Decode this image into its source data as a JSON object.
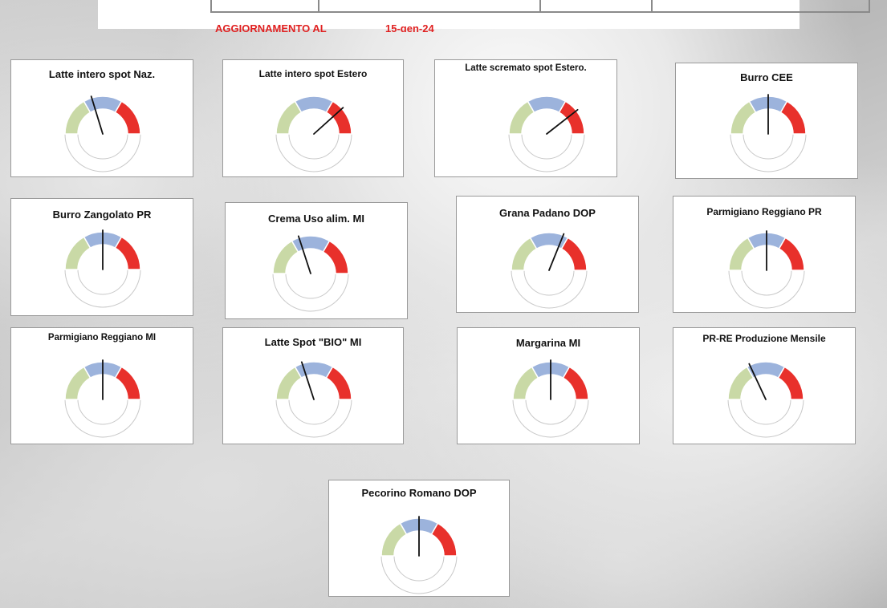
{
  "header": {
    "update_label": "AGGIORNAMENTO AL",
    "update_date": "15-gen-24"
  },
  "colors": {
    "low": "#c9d9a6",
    "mid": "#9cb3dc",
    "high": "#e8302b",
    "needle": "#111111",
    "update_text": "#e02020"
  },
  "gauges": [
    {
      "title": "Latte intero spot Naz.",
      "needle_angle_deg": -17
    },
    {
      "title": "Latte intero spot Estero",
      "needle_angle_deg": 48
    },
    {
      "title": "Latte scremato spot Estero.",
      "needle_angle_deg": 52
    },
    {
      "title": "Burro CEE",
      "needle_angle_deg": 0
    },
    {
      "title": "Burro Zangolato PR",
      "needle_angle_deg": 0
    },
    {
      "title": "Crema Uso alim. MI",
      "needle_angle_deg": -18
    },
    {
      "title": "Grana Padano DOP",
      "needle_angle_deg": 22
    },
    {
      "title": "Parmigiano Reggiano PR",
      "needle_angle_deg": 0
    },
    {
      "title": "Parmigiano Reggiano MI",
      "needle_angle_deg": 0
    },
    {
      "title": "Latte Spot \"BIO\" MI",
      "needle_angle_deg": -18
    },
    {
      "title": "Margarina MI",
      "needle_angle_deg": 0
    },
    {
      "title": "PR-RE Produzione Mensile",
      "needle_angle_deg": -25
    },
    {
      "title": "Pecorino Romano DOP",
      "needle_angle_deg": 0
    }
  ]
}
